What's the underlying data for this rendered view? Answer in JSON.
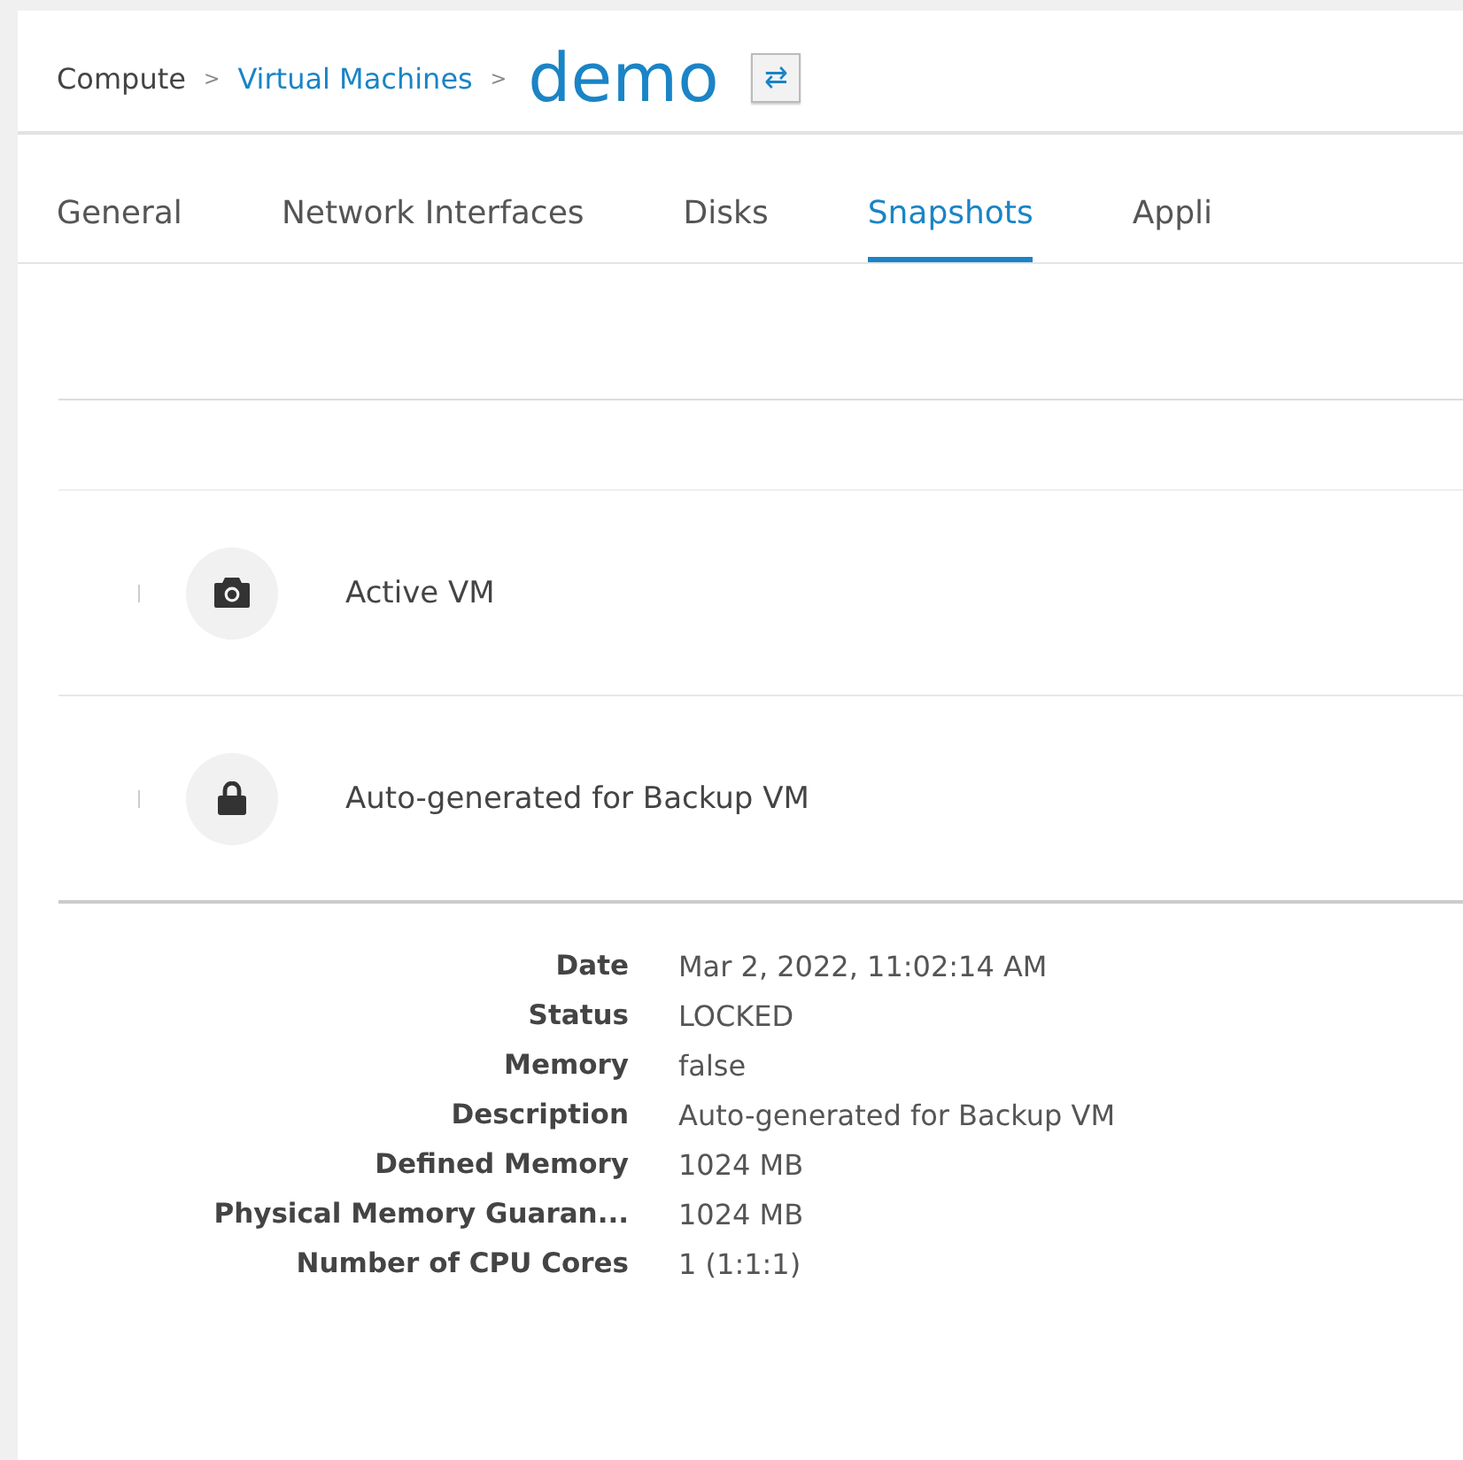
{
  "breadcrumb": {
    "items": [
      {
        "label": "Compute",
        "kind": "text"
      },
      {
        "label": "Virtual Machines",
        "kind": "link"
      }
    ],
    "separator": ">",
    "title": "demo",
    "switch_button": "⇄"
  },
  "tabs": [
    {
      "label": "General",
      "selected": false
    },
    {
      "label": "Network Interfaces",
      "selected": false
    },
    {
      "label": "Disks",
      "selected": false
    },
    {
      "label": "Snapshots",
      "selected": true
    },
    {
      "label": "Appli",
      "selected": false
    }
  ],
  "snapshots": [
    {
      "name": "Active VM",
      "kind": "camera",
      "expanded": false
    },
    {
      "name": "Auto-generated for Backup VM",
      "kind": "lock",
      "expanded": true,
      "details": [
        {
          "label": "Date",
          "value": "Mar 2, 2022, 11:02:14 AM"
        },
        {
          "label": "Status",
          "value": "LOCKED"
        },
        {
          "label": "Memory",
          "value": "false"
        },
        {
          "label": "Description",
          "value": "Auto-generated for Backup VM"
        },
        {
          "label": "Defined Memory",
          "value": "1024 MB"
        },
        {
          "label": "Physical Memory Guaran...",
          "value": "1024 MB"
        },
        {
          "label": "Number of CPU Cores",
          "value": "1 (1:1:1)"
        }
      ]
    }
  ]
}
